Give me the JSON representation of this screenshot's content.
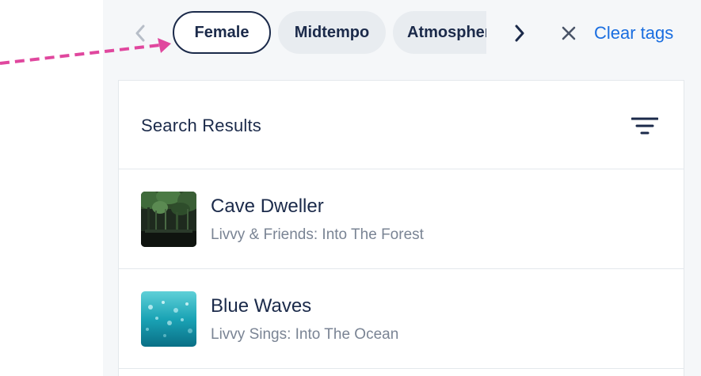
{
  "tags": {
    "chips": [
      {
        "label": "Female",
        "active": true
      },
      {
        "label": "Midtempo",
        "active": false
      },
      {
        "label": "Atmospheric",
        "active": false
      }
    ],
    "clear_label": "Clear tags",
    "prev_icon": "chevron-left-icon",
    "next_icon": "chevron-right-icon",
    "clear_icon": "close-icon"
  },
  "results": {
    "title": "Search Results",
    "filter_icon": "filter-icon",
    "items": [
      {
        "title": "Cave Dweller",
        "subtitle": "Livvy & Friends: Into The Forest",
        "thumb": "forest-cave-art"
      },
      {
        "title": "Blue Waves",
        "subtitle": "Livvy Sings: Into The Ocean",
        "thumb": "ocean-water-art"
      }
    ]
  },
  "annotation": {
    "arrow_color": "#e0479e"
  },
  "colors": {
    "navy": "#1b2a4a",
    "link_blue": "#1a6ee0",
    "chip_bg": "#e8ecf0",
    "muted_text": "#7a8494",
    "panel_bg": "#f5f7f9"
  }
}
